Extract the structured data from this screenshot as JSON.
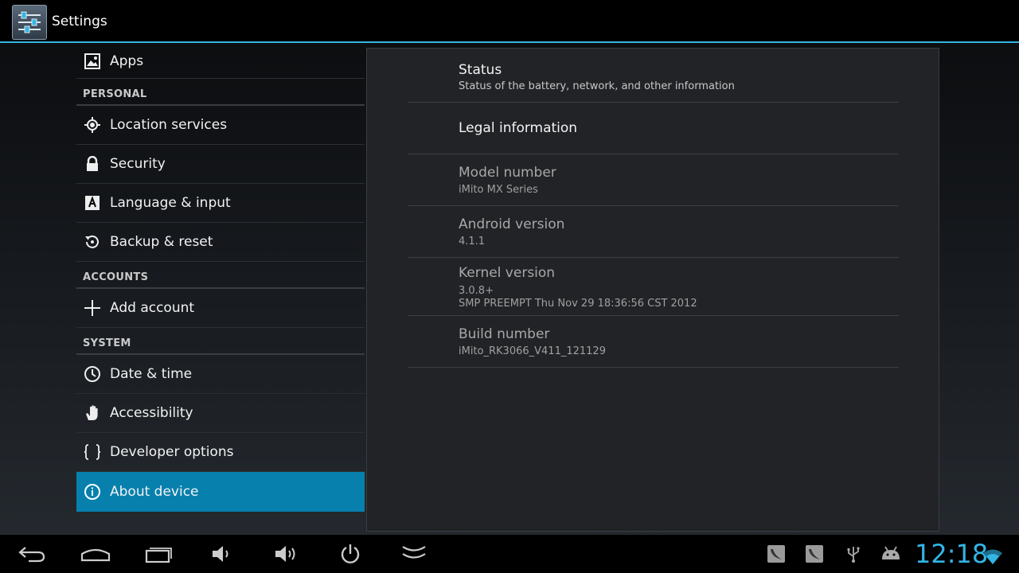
{
  "actionbar": {
    "title": "Settings"
  },
  "sidebar": {
    "top_item": {
      "label": "Apps"
    },
    "personal_header": "PERSONAL",
    "personal": [
      {
        "label": "Location services"
      },
      {
        "label": "Security"
      },
      {
        "label": "Language & input"
      },
      {
        "label": "Backup & reset"
      }
    ],
    "accounts_header": "ACCOUNTS",
    "accounts": [
      {
        "label": "Add account"
      }
    ],
    "system_header": "SYSTEM",
    "system": [
      {
        "label": "Date & time"
      },
      {
        "label": "Accessibility"
      },
      {
        "label": "Developer options"
      },
      {
        "label": "About device"
      }
    ],
    "selected": "About device"
  },
  "about": {
    "items": [
      {
        "title": "Status",
        "summary": "Status of the battery, network, and other information"
      },
      {
        "title": "Legal information",
        "summary": ""
      },
      {
        "title": "Model number",
        "summary": "iMito MX Series"
      },
      {
        "title": "Android version",
        "summary": "4.1.1"
      },
      {
        "title": "Kernel version",
        "summary": "3.0.8+",
        "summary2": "SMP PREEMPT Thu Nov 29 18:36:56 CST 2012"
      },
      {
        "title": "Build number",
        "summary": "iMito_RK3066_V411_121129"
      }
    ]
  },
  "statusbar": {
    "time": "12:18"
  },
  "colors": {
    "accent": "#33b5e5",
    "selected": "#0780ae"
  }
}
